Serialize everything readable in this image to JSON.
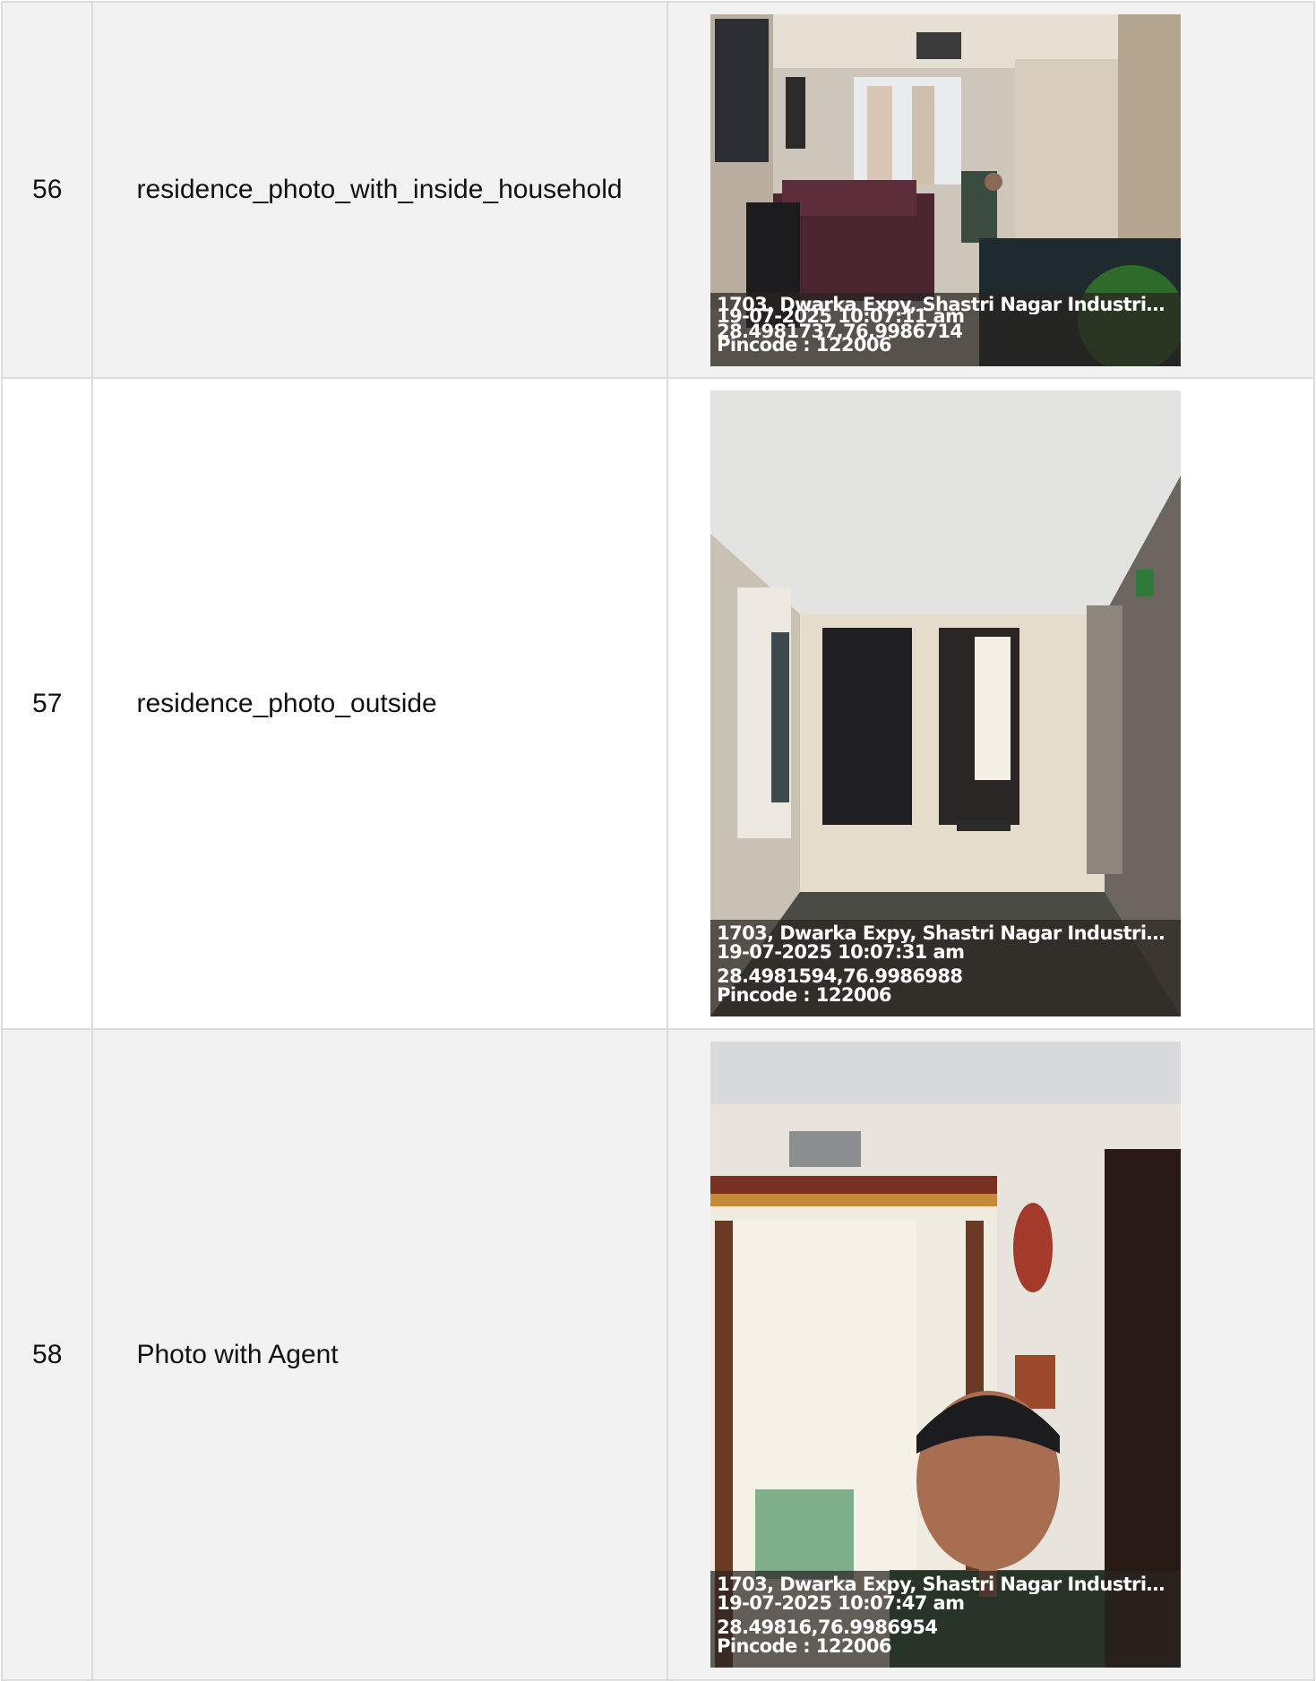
{
  "rows": [
    {
      "index": "56",
      "label": "residence_photo_with_inside_household",
      "photo": {
        "address": "1703, Dwarka Expy, Shastri Nagar Industrial ...",
        "datetime": "19-07-2025 10:07:11 am",
        "coords": "28.4981737,76.9986714",
        "pincode": "Pincode : 122006"
      }
    },
    {
      "index": "57",
      "label": "residence_photo_outside",
      "photo": {
        "address": "1703, Dwarka Expy, Shastri Nagar Industrial ...",
        "datetime": "19-07-2025 10:07:31 am",
        "coords": "28.4981594,76.9986988",
        "pincode": "Pincode : 122006"
      }
    },
    {
      "index": "58",
      "label": "Photo with Agent",
      "photo": {
        "address": "1703, Dwarka Expy, Shastri Nagar Industrial ...",
        "datetime": "19-07-2025 10:07:47 am",
        "coords": "28.49816,76.9986954",
        "pincode": "Pincode : 122006"
      }
    }
  ],
  "colors": {
    "row_shade": "#f2f2f2",
    "row_plain": "#ffffff",
    "grid_line": "#dcdcdc"
  }
}
